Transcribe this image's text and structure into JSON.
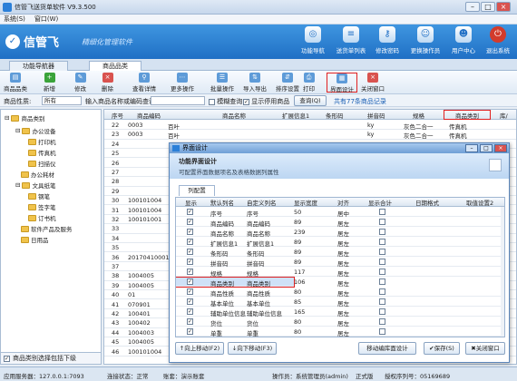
{
  "window": {
    "title": "信管飞送货单软件 V9.3.500"
  },
  "menu": [
    "系统(S)",
    "窗口(W)"
  ],
  "brand": {
    "name": "信管飞",
    "slogan": "精细化管理软件"
  },
  "top_buttons": [
    {
      "label": "功能导航",
      "icon": "compass-icon"
    },
    {
      "label": "送货单列表",
      "icon": "list-icon"
    },
    {
      "label": "修改密码",
      "icon": "key-icon"
    },
    {
      "label": "更换操作员",
      "icon": "users-icon"
    },
    {
      "label": "用户中心",
      "icon": "user-icon"
    },
    {
      "label": "退出系统",
      "icon": "power-icon"
    }
  ],
  "tabs": [
    "功能导航器",
    "商品品类"
  ],
  "toolbar": [
    "商品品类",
    "新增",
    "修改",
    "删除",
    "查看详情",
    "更多操作",
    "批量操作",
    "导入导出",
    "排序设置",
    "打印",
    "界面设计",
    "关闭窗口"
  ],
  "filter": {
    "category_label": "商品性质:",
    "category_value": "所有",
    "search_label": "输入商品名称或编码查询:",
    "search_value": "",
    "fuzzy_label": "模糊查询",
    "fuzzy_checked": false,
    "show_disabled_label": "显示停用商品",
    "show_disabled_checked": true,
    "query_button": "查询(Q)",
    "count_text": "共有77条商品记录"
  },
  "tree": {
    "root": "商品类别",
    "nodes": [
      {
        "label": "办公设备",
        "level": 1
      },
      {
        "label": "打印机",
        "level": 2
      },
      {
        "label": "传真机",
        "level": 2
      },
      {
        "label": "扫描仪",
        "level": 2
      },
      {
        "label": "办公耗材",
        "level": 1
      },
      {
        "label": "文具纸笔",
        "level": 1
      },
      {
        "label": "钢笔",
        "level": 2
      },
      {
        "label": "签字笔",
        "level": 2
      },
      {
        "label": "订书机",
        "level": 2
      },
      {
        "label": "软件产品及服务",
        "level": 1
      },
      {
        "label": "日用品",
        "level": 1
      }
    ],
    "footer": "商品类别选择包括下级"
  },
  "grid": {
    "headers": [
      "序号",
      "商品编码",
      "商品名称",
      "扩展信息1",
      "条形码",
      "拼音码",
      "规格",
      "商品类别",
      "库/"
    ],
    "rows": [
      [
        "22",
        "0003",
        "百叶",
        "",
        "",
        "ky",
        "灰色二合一",
        "传真机"
      ],
      [
        "23",
        "0003",
        "百叶",
        "",
        "",
        "ky",
        "灰色二合一",
        "传真机"
      ],
      [
        "24",
        "",
        "",
        "",
        "",
        "",
        "",
        ""
      ],
      [
        "25",
        "",
        "",
        "",
        "",
        "",
        "",
        ""
      ],
      [
        "26",
        "",
        "",
        "",
        "",
        "",
        "",
        ""
      ],
      [
        "27",
        "",
        "",
        "",
        "",
        "",
        "",
        ""
      ],
      [
        "28",
        "",
        "",
        "",
        "",
        "",
        "",
        ""
      ],
      [
        "29",
        "",
        "",
        "",
        "",
        "",
        "",
        ""
      ],
      [
        "30",
        "100101004",
        "",
        "",
        "",
        "",
        "",
        ""
      ],
      [
        "31",
        "100101004",
        "",
        "",
        "",
        "",
        "",
        ""
      ],
      [
        "32",
        "100101001",
        "",
        "",
        "",
        "",
        "",
        ""
      ],
      [
        "33",
        "",
        "",
        "",
        "",
        "",
        "",
        ""
      ],
      [
        "34",
        "",
        "",
        "",
        "",
        "",
        "",
        ""
      ],
      [
        "35",
        "",
        "",
        "",
        "",
        "",
        "",
        ""
      ],
      [
        "36",
        "20170410001",
        "",
        "",
        "",
        "",
        "",
        ""
      ],
      [
        "37",
        "",
        "",
        "",
        "",
        "",
        "",
        ""
      ],
      [
        "38",
        "1004005",
        "",
        "",
        "",
        "",
        "",
        ""
      ],
      [
        "39",
        "1004005",
        "",
        "",
        "",
        "",
        "",
        ""
      ],
      [
        "40",
        "01",
        "",
        "",
        "",
        "",
        "",
        ""
      ],
      [
        "41",
        "070901",
        "",
        "",
        "",
        "",
        "",
        ""
      ],
      [
        "42",
        "100401",
        "",
        "",
        "",
        "",
        "",
        ""
      ],
      [
        "43",
        "100402",
        "",
        "",
        "",
        "",
        "",
        ""
      ],
      [
        "44",
        "1004003",
        "",
        "",
        "",
        "",
        "",
        ""
      ],
      [
        "45",
        "1004005",
        "",
        "",
        "",
        "",
        "",
        ""
      ],
      [
        "46",
        "100101004",
        "",
        "",
        "",
        "",
        "",
        ""
      ]
    ]
  },
  "dialog": {
    "title": "界面设计",
    "header_title": "功能界面设计",
    "header_desc": "可配置界面数据项名及表格数据列属性",
    "tab": "列配置",
    "headers": [
      "显示",
      "默认列名",
      "自定义列名",
      "显示宽度",
      "对齐",
      "显示合计",
      "日期格式",
      "取值设置2"
    ],
    "rows": [
      [
        true,
        "序号",
        "序号",
        "50",
        "居中"
      ],
      [
        true,
        "商品编码",
        "商品编码",
        "89",
        "居左"
      ],
      [
        true,
        "商品名称",
        "商品名称",
        "239",
        "居左"
      ],
      [
        true,
        "扩展信息1",
        "扩展信息1",
        "89",
        "居左"
      ],
      [
        true,
        "条形码",
        "条形码",
        "89",
        "居左"
      ],
      [
        true,
        "拼音码",
        "拼音码",
        "89",
        "居左"
      ],
      [
        true,
        "规格",
        "规格",
        "117",
        "居左"
      ],
      [
        true,
        "商品类别",
        "商品类别",
        "106",
        "居左"
      ],
      [
        true,
        "商品性质",
        "商品性质",
        "80",
        "居左"
      ],
      [
        true,
        "基本单位",
        "基本单位",
        "85",
        "居左"
      ],
      [
        true,
        "辅助单位信息",
        "辅助单位信息",
        "165",
        "居左"
      ],
      [
        true,
        "货位",
        "货位",
        "80",
        "居左"
      ],
      [
        true,
        "单重",
        "单重",
        "80",
        "居左"
      ]
    ],
    "buttons": {
      "up": "向上移动(F2)",
      "down": "向下移动(F3)",
      "move": "移动编库面设计",
      "save": "保存(S)",
      "close": "关闭窗口"
    }
  },
  "status": {
    "server": "应用服务器：127.0.0.1:7093",
    "conn": "连接状态：正常",
    "account": "账套：演示账套",
    "operator": "操作员：系统管理员(admin)",
    "edition": "正式版",
    "license": "授权序列号：05169689"
  },
  "colors": {
    "banner": "#2a80d4",
    "highlight": "#e02020",
    "selected_row": "#cfe1f7"
  }
}
